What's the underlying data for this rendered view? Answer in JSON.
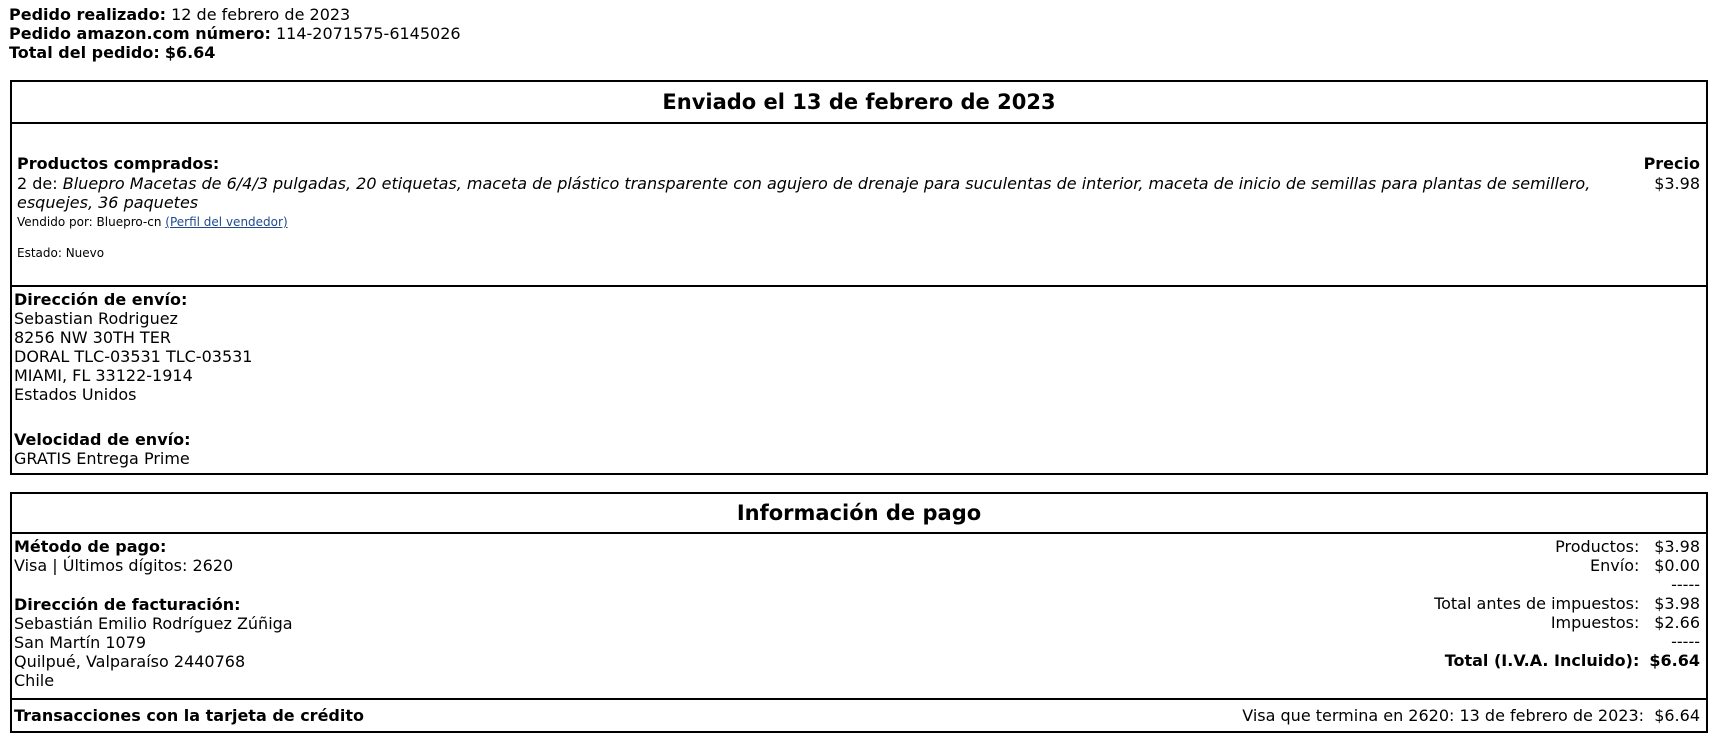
{
  "order": {
    "placed_label": "Pedido realizado:",
    "placed_value": "12 de febrero de 2023",
    "number_label": "Pedido amazon.com número:",
    "number_value": "114-2071575-6145026",
    "total_label": "Total del pedido:",
    "total_value": "$6.64"
  },
  "shipment": {
    "title": "Enviado el 13 de febrero de 2023",
    "products_label": "Productos comprados:",
    "price_label": "Precio",
    "item_qty": "2 de:",
    "item_desc_line1": "Bluepro Macetas de 6/4/3 pulgadas, 20 etiquetas, maceta de plástico transparente con agujero de drenaje para suculentas de interior, maceta de inicio de semillas para plantas de semillero,",
    "item_desc_line2": "esquejes, 36 paquetes",
    "item_price": "$3.98",
    "sold_by_label": "Vendido por: Bluepro-cn",
    "seller_profile": "(Perfil del vendedor)",
    "condition": "Estado: Nuevo",
    "address_label": "Dirección de envío:",
    "address_lines": [
      "Sebastian Rodriguez",
      "8256 NW 30TH TER",
      "DORAL TLC-03531 TLC-03531",
      "MIAMI, FL 33122-1914",
      "Estados Unidos"
    ],
    "speed_label": "Velocidad de envío:",
    "speed_value": "GRATIS Entrega Prime"
  },
  "payment": {
    "title": "Información de pago",
    "method_label": "Método de pago:",
    "method_value": "Visa | Últimos dígitos: 2620",
    "billing_label": "Dirección de facturación:",
    "billing_lines": [
      "Sebastián Emilio Rodríguez Zúñiga",
      "San Martín 1079",
      "Quilpué, Valparaíso 2440768",
      "Chile"
    ],
    "summary": {
      "products_label": "Productos:",
      "products_value": "$3.98",
      "shipping_label": "Envío:",
      "shipping_value": "$0.00",
      "sep1": "-----",
      "pretax_label": "Total antes de impuestos:",
      "pretax_value": "$3.98",
      "tax_label": "Impuestos:",
      "tax_value": "$2.66",
      "sep2": "-----",
      "total_label": "Total (I.V.A. Incluido):",
      "total_value": "$6.64"
    },
    "transactions_label": "Transacciones con la tarjeta de crédito",
    "transaction_text": "Visa que termina en 2620: 13 de febrero de 2023:",
    "transaction_amount": "$6.64"
  }
}
